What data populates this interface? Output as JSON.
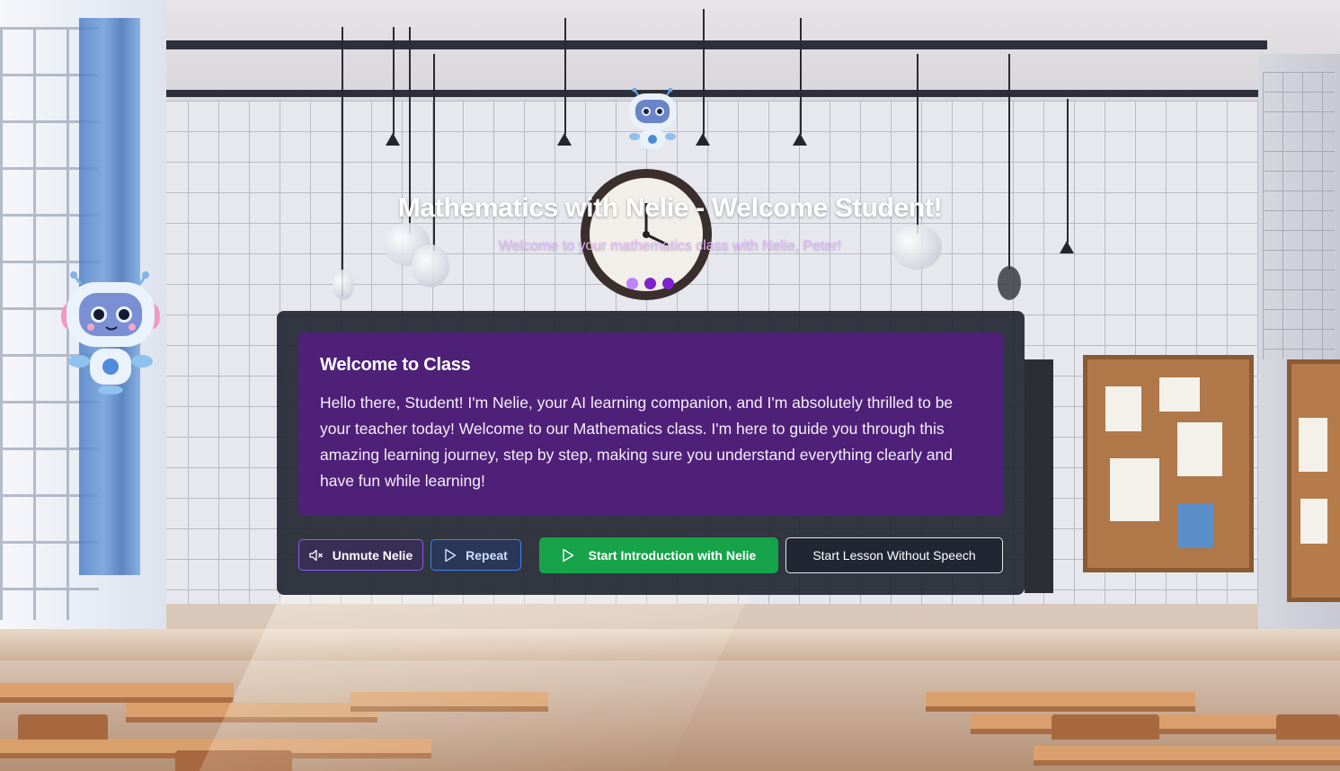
{
  "header": {
    "title": "Mathematics with Nelie - Welcome Student!",
    "subtitle": "Welcome to your mathematics class with Nelie, Peter!"
  },
  "progress_dots": [
    {
      "state": "current",
      "color": "#c084fc"
    },
    {
      "state": "upcoming",
      "color": "#7e22ce"
    },
    {
      "state": "upcoming",
      "color": "#7e22ce"
    }
  ],
  "message": {
    "heading": "Welcome to Class",
    "body": "Hello there, Student! I'm Nelie, your AI learning companion, and I'm absolutely thrilled to be your teacher today! Welcome to our Mathematics class. I'm here to guide you through this amazing learning journey, step by step, making sure you understand everything clearly and have fun while learning!"
  },
  "controls": {
    "unmute_label": "Unmute Nelie",
    "repeat_label": "Repeat",
    "start_label": "Start Introduction with Nelie",
    "no_speech_label": "Start Lesson Without Speech"
  },
  "icons": {
    "unmute": "volume-muted-icon",
    "repeat": "play-icon",
    "start": "play-icon"
  },
  "colors": {
    "message_bg": "#4f2078",
    "panel_bg": "#222632",
    "start_button": "#16a34a",
    "subtitle": "#e6b8ff"
  }
}
